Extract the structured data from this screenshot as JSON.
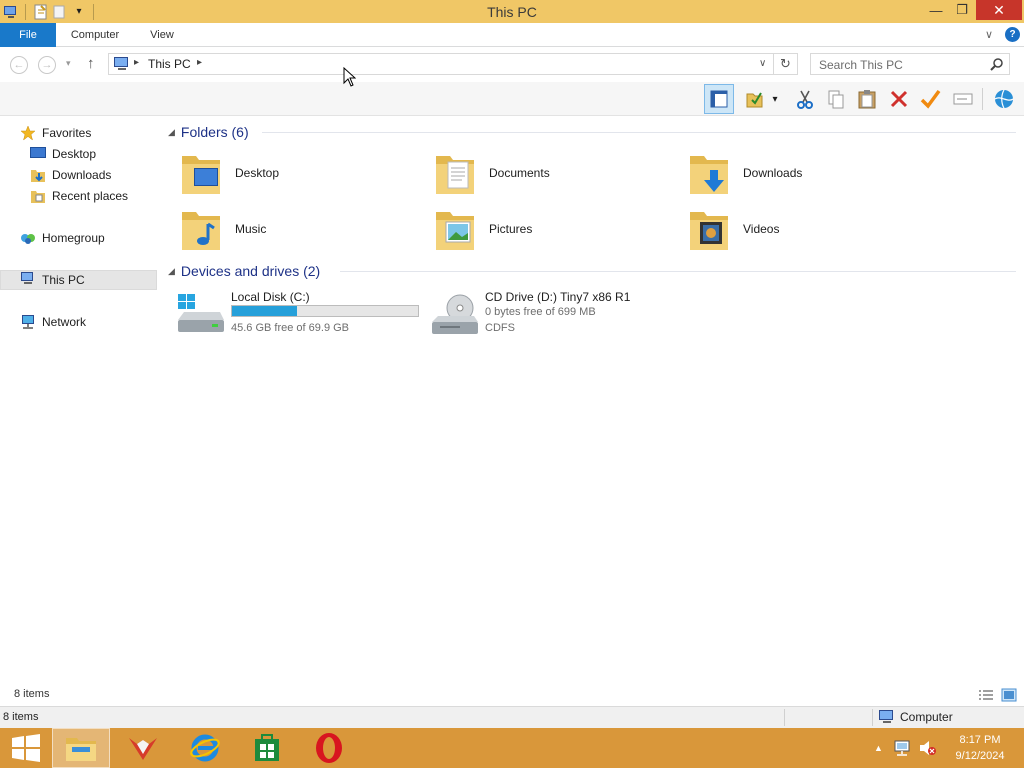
{
  "window": {
    "title": "This PC",
    "controls": {
      "minimize": "—",
      "maximize": "❐",
      "close": "✕"
    }
  },
  "ribbon": {
    "tabs": [
      {
        "label": "File"
      },
      {
        "label": "Computer"
      },
      {
        "label": "View"
      }
    ],
    "collapse_glyph": "∨",
    "help_glyph": "?"
  },
  "address": {
    "path": "This PC",
    "search_placeholder": "Search This PC"
  },
  "toolbar": {
    "buttons": [
      "layout-pane",
      "properties",
      "cut",
      "copy",
      "paste",
      "delete",
      "check",
      "rename",
      "globe"
    ]
  },
  "nav": {
    "favorites": "Favorites",
    "desktop": "Desktop",
    "downloads": "Downloads",
    "recent": "Recent places",
    "homegroup": "Homegroup",
    "thispc": "This PC",
    "network": "Network"
  },
  "content": {
    "folders_header": "Folders (6)",
    "folders": [
      {
        "name": "Desktop",
        "icon": "desktop-folder-icon"
      },
      {
        "name": "Documents",
        "icon": "documents-folder-icon"
      },
      {
        "name": "Downloads",
        "icon": "downloads-folder-icon"
      },
      {
        "name": "Music",
        "icon": "music-folder-icon"
      },
      {
        "name": "Pictures",
        "icon": "pictures-folder-icon"
      },
      {
        "name": "Videos",
        "icon": "videos-folder-icon"
      }
    ],
    "drives_header": "Devices and drives (2)",
    "drives": [
      {
        "name": "Local Disk (C:)",
        "free": "45.6 GB free of 69.9 GB",
        "used_fraction": 0.35
      },
      {
        "name": "CD Drive (D:) Tiny7 x86 R1",
        "free": "0 bytes free of 699 MB",
        "fs": "CDFS"
      }
    ]
  },
  "status": {
    "items": "8 items",
    "bar_items": "8 items",
    "location": "Computer"
  },
  "taskbar": {
    "time": "8:17 PM",
    "date": "9/12/2024"
  },
  "colors": {
    "titlebar": "#f0c766",
    "file_tab": "#1979ca",
    "taskbar": "#d9973a",
    "drive_fill": "#26a0da"
  }
}
